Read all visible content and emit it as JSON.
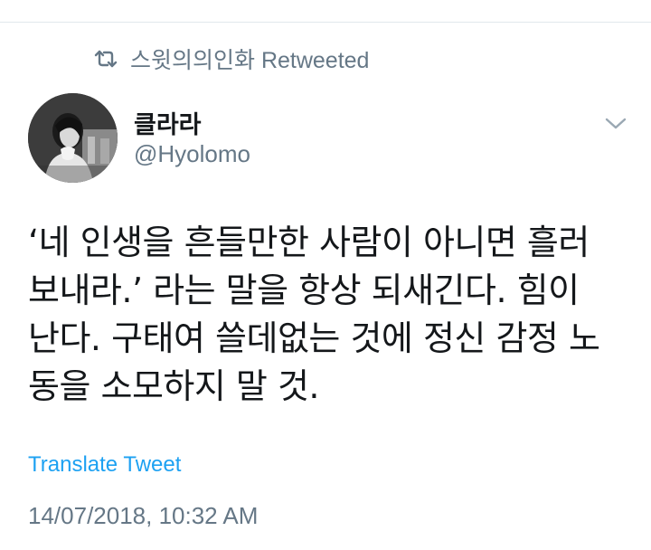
{
  "retweet": {
    "icon": "retweet-icon",
    "text": "스윗의의인화 Retweeted"
  },
  "author": {
    "avatar_icon": "avatar-photo",
    "display_name": "클라라",
    "handle": "@Hyolomo"
  },
  "menu": {
    "icon": "chevron-down-icon"
  },
  "tweet": {
    "lines": [
      "‘네 인생을 흔들만한 사람이 아니면 흘러",
      "보내라.’ 라는 말을 항상 되새긴다. 힘이",
      "난다. 구태여 쓸데없는 것에 정신 감정 노",
      "동을 소모하지 말 것."
    ],
    "translate_label": "Translate Tweet",
    "timestamp": "14/07/2018, 10:32 AM"
  },
  "colors": {
    "text": "#14171a",
    "secondary": "#657786",
    "link": "#1da1f2",
    "divider": "#e1e8ed"
  }
}
